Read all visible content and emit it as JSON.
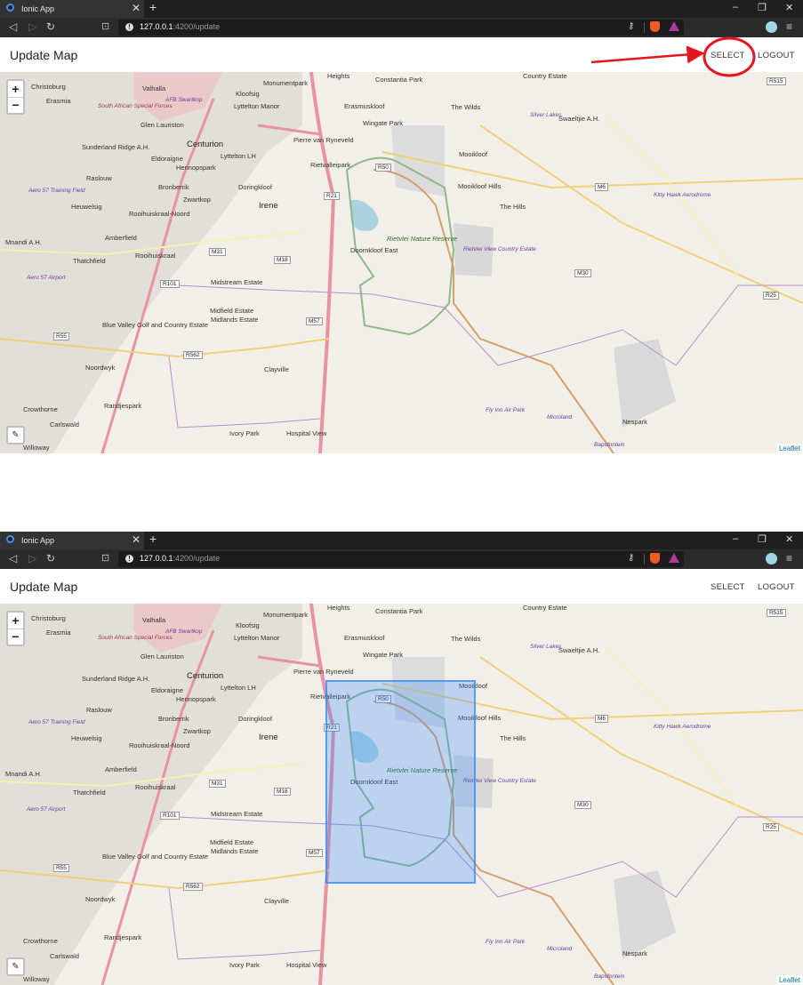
{
  "browser": {
    "tab_title": "Ionic App",
    "tab_close": "✕",
    "new_tab": "+",
    "url_host": "127.0.0.1",
    "url_rest": ":4200/update",
    "win_min": "–",
    "win_restore": "❐",
    "win_close": "✕",
    "back": "◁",
    "forward": "▷",
    "reload": "↻",
    "bookmark": "⊡",
    "key": "⚷",
    "menu": "≡",
    "info": "!"
  },
  "app": {
    "title": "Update Map",
    "select_label": "SELECT",
    "logout_label": "LOGOUT"
  },
  "map": {
    "zoom_in": "+",
    "zoom_out": "−",
    "draw_icon": "✎",
    "attribution": "Leaflet",
    "labels": [
      {
        "t": "Christoburg",
        "c": ""
      },
      {
        "t": "Erasmia",
        "c": ""
      },
      {
        "t": "Valhalla",
        "c": ""
      },
      {
        "t": "AFB Swartkop",
        "c": "purple"
      },
      {
        "t": "Monumentpark",
        "c": ""
      },
      {
        "t": "Heights",
        "c": ""
      },
      {
        "t": "Constantia Park",
        "c": ""
      },
      {
        "t": "Kloofsig",
        "c": ""
      },
      {
        "t": "Lyttelton Manor",
        "c": ""
      },
      {
        "t": "Erasmuskloof",
        "c": ""
      },
      {
        "t": "The Wilds",
        "c": ""
      },
      {
        "t": "Wingate Park",
        "c": ""
      },
      {
        "t": "South African Special Forces",
        "c": "pink"
      },
      {
        "t": "Glen Lauriston",
        "c": ""
      },
      {
        "t": "Centurion",
        "c": "big"
      },
      {
        "t": "Pierre van Ryneveld",
        "c": ""
      },
      {
        "t": "Lyttelton LH",
        "c": ""
      },
      {
        "t": "Sunderland Ridge A.H.",
        "c": ""
      },
      {
        "t": "Eldoraigne",
        "c": ""
      },
      {
        "t": "Hennopspark",
        "c": ""
      },
      {
        "t": "Rietvalleipark",
        "c": ""
      },
      {
        "t": "Mooikloof",
        "c": ""
      },
      {
        "t": "Silver Lakes",
        "c": "purple"
      },
      {
        "t": "Swaeltjie A.H.",
        "c": ""
      },
      {
        "t": "Raslouw",
        "c": ""
      },
      {
        "t": "Bronberrik",
        "c": ""
      },
      {
        "t": "Doringkloof",
        "c": ""
      },
      {
        "t": "Mooikloof Hills",
        "c": ""
      },
      {
        "t": "Zwartkop",
        "c": ""
      },
      {
        "t": "Irene",
        "c": "big"
      },
      {
        "t": "The Hills",
        "c": ""
      },
      {
        "t": "Kitty Hawk Aerodrome",
        "c": "purple"
      },
      {
        "t": "Aero 57 Training Field",
        "c": "purple"
      },
      {
        "t": "Heuwelsig",
        "c": ""
      },
      {
        "t": "Rooihuiskraal-Noord",
        "c": ""
      },
      {
        "t": "Amberfield",
        "c": ""
      },
      {
        "t": "Mnandi A.H.",
        "c": ""
      },
      {
        "t": "Thatchfield",
        "c": ""
      },
      {
        "t": "Rooihuiskraal",
        "c": ""
      },
      {
        "t": "Rietvlei Nature Reserve",
        "c": "green"
      },
      {
        "t": "Doornkloof East",
        "c": ""
      },
      {
        "t": "Rietvlei View Country Estate",
        "c": "purple"
      },
      {
        "t": "Aero 57 Airport",
        "c": "purple"
      },
      {
        "t": "Midstream Estate",
        "c": ""
      },
      {
        "t": "Midfield Estate",
        "c": ""
      },
      {
        "t": "Midlands Estate",
        "c": ""
      },
      {
        "t": "Blue Valley Golf and Country Estate",
        "c": ""
      },
      {
        "t": "Noordwyk",
        "c": ""
      },
      {
        "t": "Clayville",
        "c": ""
      },
      {
        "t": "Crowthorne",
        "c": ""
      },
      {
        "t": "Randjespark",
        "c": ""
      },
      {
        "t": "Carlswald",
        "c": ""
      },
      {
        "t": "Fly Inn Air Park",
        "c": "purple"
      },
      {
        "t": "Microland",
        "c": "purple"
      },
      {
        "t": "Nespark",
        "c": ""
      },
      {
        "t": "Ivory Park",
        "c": ""
      },
      {
        "t": "Hospital View",
        "c": ""
      },
      {
        "t": "Willoway",
        "c": ""
      },
      {
        "t": "Bapsfontein",
        "c": "purple"
      },
      {
        "t": "Country Estate",
        "c": ""
      }
    ],
    "shields": [
      "R515",
      "R50",
      "R21",
      "M6",
      "M31",
      "M18",
      "R101",
      "M30",
      "R25",
      "R55",
      "R562",
      "M57"
    ]
  }
}
